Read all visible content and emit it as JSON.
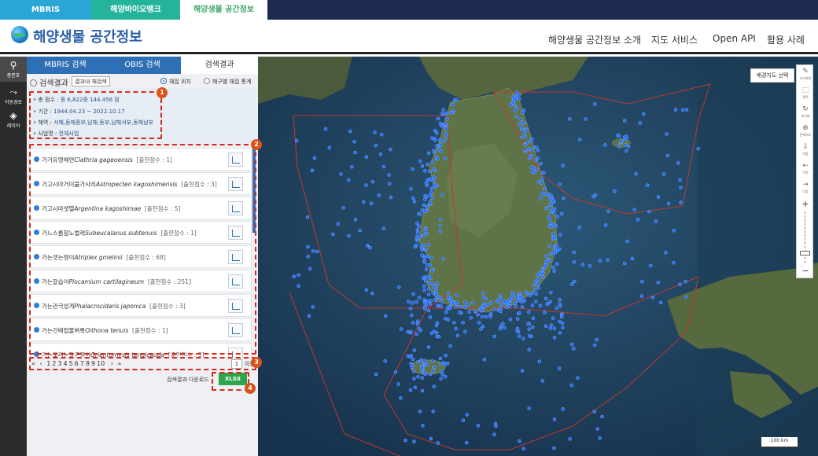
{
  "top_tabs": [
    "MBRIS",
    "해양바이오뱅크",
    "해양생물 공간정보"
  ],
  "header": {
    "title": "해양생물 공간정보",
    "nav": [
      "해양생물 공간정보 소개",
      "지도 서비스",
      "Open API",
      "활용 사례"
    ]
  },
  "icon_strip": [
    {
      "icon": "species-distribution-icon",
      "label": "종분포"
    },
    {
      "icon": "migration-route-icon",
      "label": "이동경로"
    },
    {
      "icon": "layers-icon",
      "label": "레이어"
    }
  ],
  "panel": {
    "tabs": [
      "MBRIS 검색",
      "OBIS 검색",
      "검색결과"
    ],
    "collapse_glyph": "‹",
    "result_title": "검색결과",
    "research_button": "결과내 재검색",
    "radio_options": [
      "채집 위치",
      "해구별 채집 통계"
    ],
    "summary": [
      {
        "key": "총 점수 :",
        "value": "종 6,822종 144,456 점"
      },
      {
        "key": "기간 :",
        "value": "1944.04.23 ~ 2022.10.17"
      },
      {
        "key": "해역 :",
        "value": "서해,동해중부,남해,동부,남해서부,동해남부"
      },
      {
        "key": "사업명 :",
        "value": "전체사업"
      }
    ],
    "items": [
      {
        "korean": "가거유령해면",
        "scientific": "Clathria gageoensis",
        "count": "[출현점수 : 1]"
      },
      {
        "korean": "가고시마거미불가사리",
        "scientific": "Astropecten kagoshimensis",
        "count": "[출현점수 : 3]"
      },
      {
        "korean": "가고시마샛멸",
        "scientific": "Argentina kagoshimae",
        "count": "[출현점수 : 5]"
      },
      {
        "korean": "가느스름참노벌레",
        "scientific": "Subeucalanus subtenuis",
        "count": "[출현점수 : 1]"
      },
      {
        "korean": "가는갯는쟁이",
        "scientific": "Atriplex gmelinii",
        "count": "[출현점수 : 68]"
      },
      {
        "korean": "가는갈습이",
        "scientific": "Plocamium cartilagineum",
        "count": "[출현점수 : 251]"
      },
      {
        "korean": "가는관극성게",
        "scientific": "Phalacrocidaris japonica",
        "count": "[출현점수 : 3]"
      },
      {
        "korean": "가는건배접물벼룩",
        "scientific": "Oithona tenuis",
        "count": "[출현점수 : 1]"
      },
      {
        "korean": "가는꼬리눈알곤쟁이",
        "scientific": "Orientomysis tenuicauda",
        "count": "[출현점수 : 3]"
      }
    ],
    "pager": {
      "first": "«",
      "prev": "‹",
      "pages": [
        "1",
        "2",
        "3",
        "4",
        "5",
        "6",
        "7",
        "8",
        "9",
        "10"
      ],
      "next": "›",
      "last": "»",
      "current_input": "1",
      "goto_label": "이동"
    },
    "download_label": "검색결과 다운로드",
    "download_button": "XLSX"
  },
  "annotations": [
    "1",
    "2",
    "3",
    "4"
  ],
  "map": {
    "basemap_button": "배경지도 선택",
    "tools": [
      {
        "icon": "pencil-icon",
        "label": "거리재기"
      },
      {
        "icon": "area-icon",
        "label": "면적"
      },
      {
        "icon": "refresh-icon",
        "label": "초기화"
      },
      {
        "icon": "globe-icon",
        "label": "전체지도"
      },
      {
        "icon": "save-icon",
        "label": "저장"
      },
      {
        "icon": "arrow-left-icon",
        "label": "이전"
      },
      {
        "icon": "arrow-right-icon",
        "label": "다음"
      }
    ],
    "zoom_in": "+",
    "zoom_out": "−",
    "scale": "100 km"
  },
  "colors": {
    "tab_mbris": "#2aa6d6",
    "tab_biobank": "#23b49a",
    "accent_blue": "#2f6fb6",
    "annotation_red": "#d9261c",
    "xlsx_green": "#2ea44f",
    "point_blue": "#1f6bff"
  }
}
